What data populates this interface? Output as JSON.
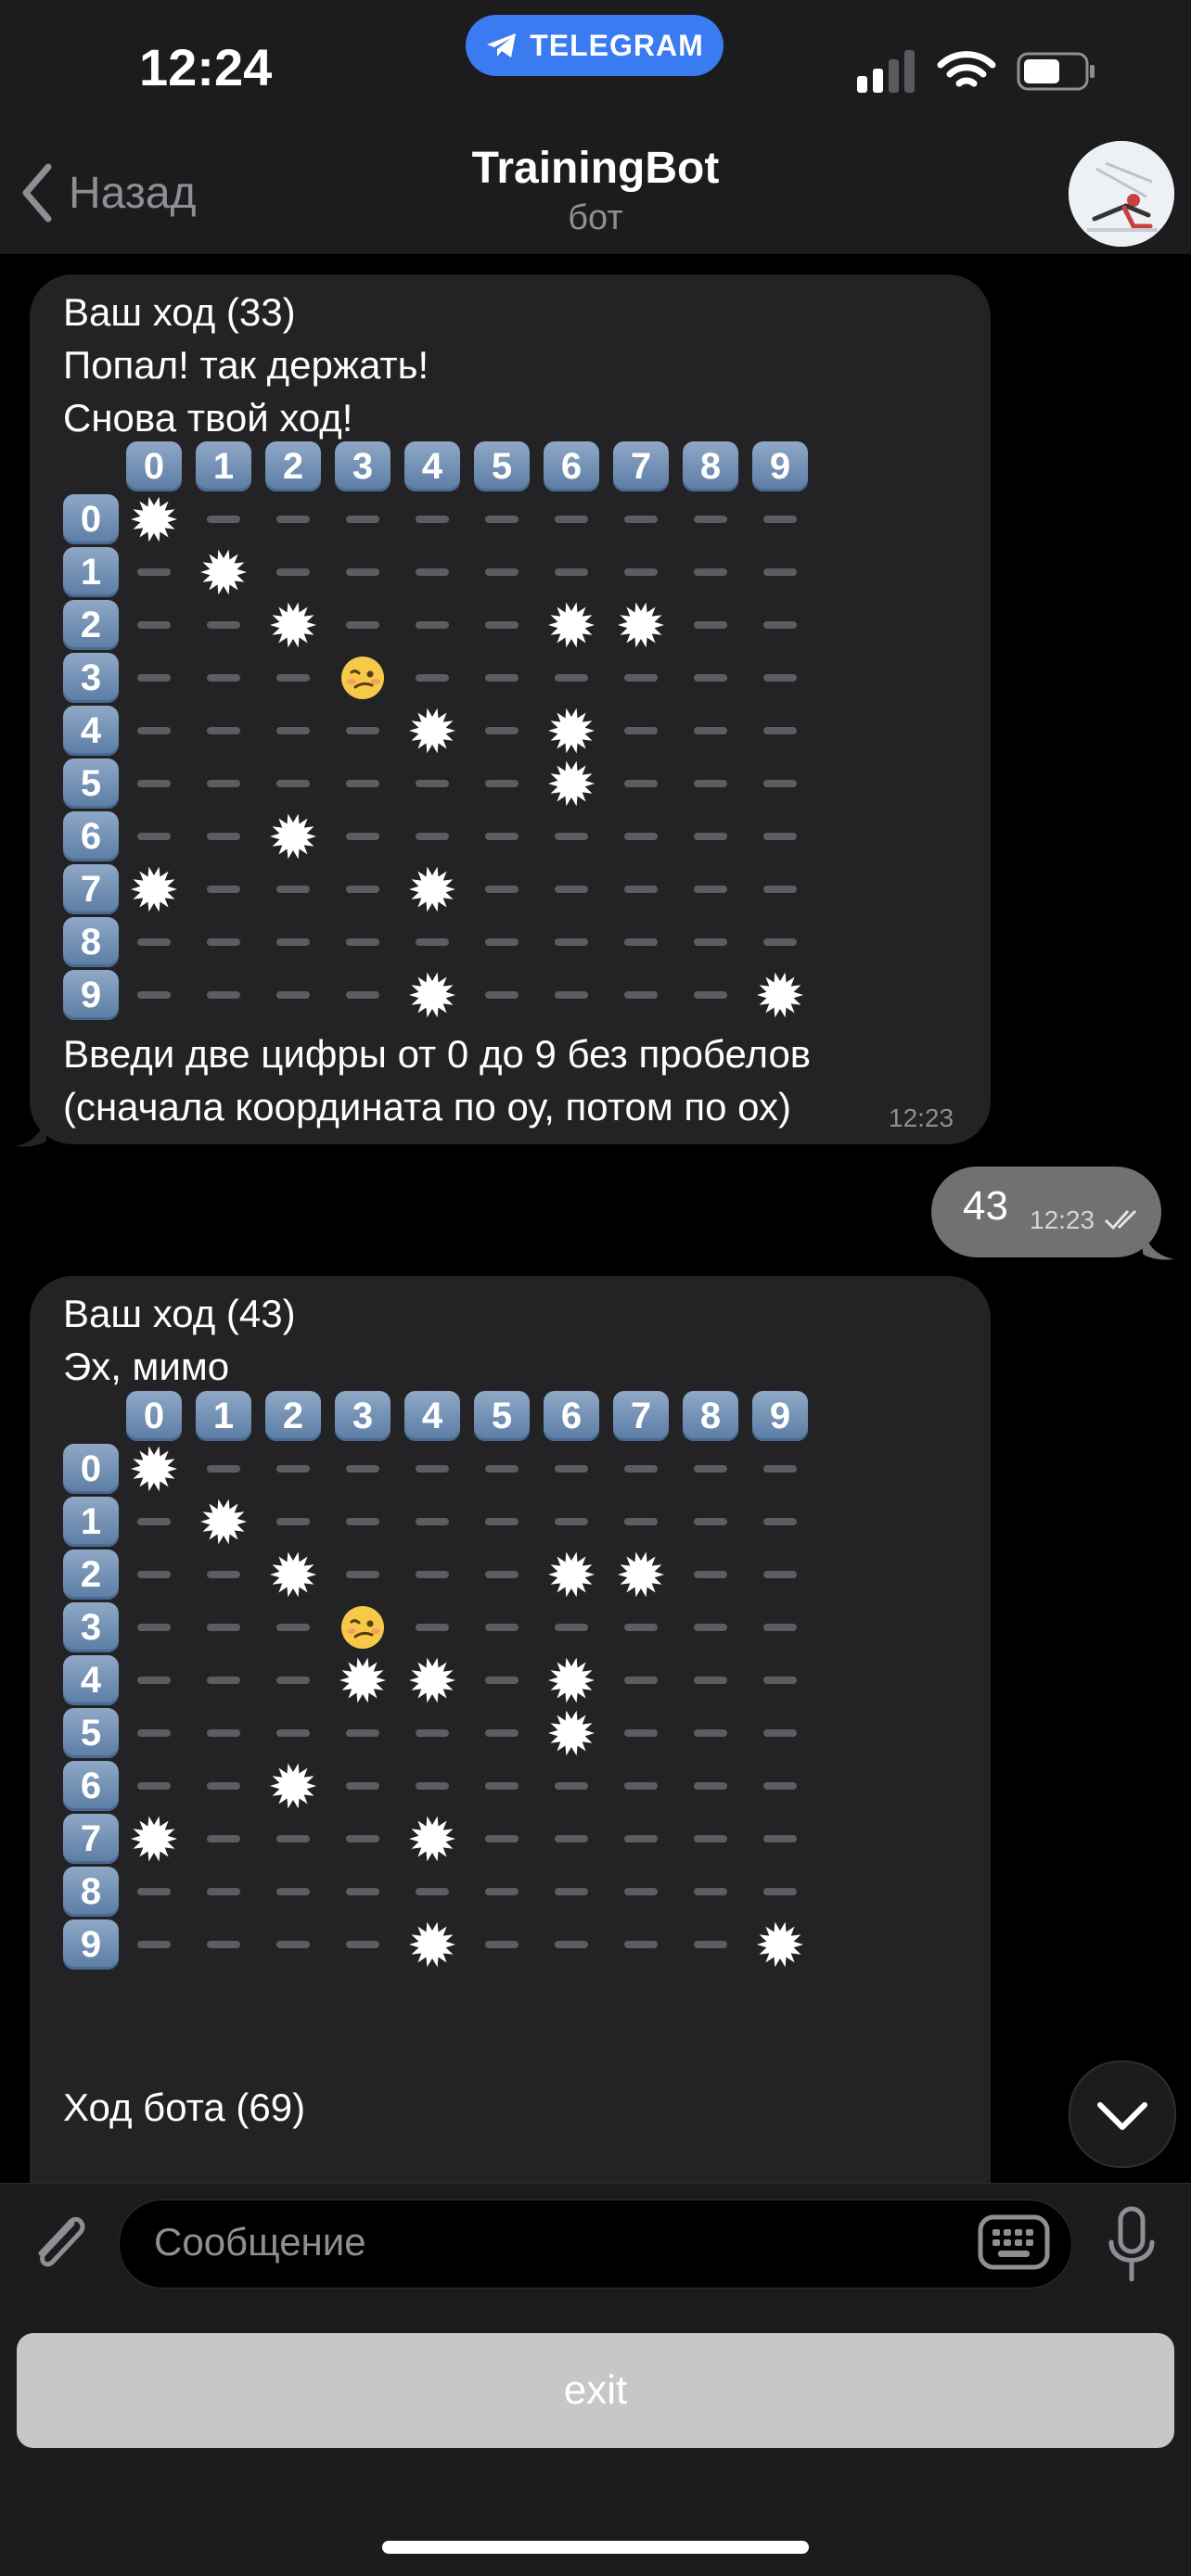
{
  "status_bar": {
    "time": "12:24",
    "app_pill": "TELEGRAM"
  },
  "nav": {
    "back_label": "Назад",
    "title": "TrainingBot",
    "subtitle": "бот"
  },
  "messages": [
    {
      "lines": [
        "Ваш ход (33)",
        "Попал! так держать!",
        "Снова твой ход!"
      ],
      "board": {
        "col_headers": [
          "0",
          "1",
          "2",
          "3",
          "4",
          "5",
          "6",
          "7",
          "8",
          "9"
        ],
        "row_headers": [
          "0",
          "1",
          "2",
          "3",
          "4",
          "5",
          "6",
          "7",
          "8",
          "9"
        ],
        "rows": [
          "X---------",
          "-X--------",
          "--X---XX--",
          "---O------",
          "----X-X---",
          "------X---",
          "--X-------",
          "X---X-----",
          "----------",
          "----X----X"
        ]
      },
      "footer_lines": [
        "Введи две цифры от 0 до 9 без пробелов",
        "(сначала координата по оу, потом по ох)"
      ],
      "time": "12:23"
    },
    {
      "outgoing_text": "43",
      "time": "12:23",
      "status_icon": "double-check-icon"
    },
    {
      "lines": [
        "Ваш ход (43)",
        "Эх, мимо"
      ],
      "board": {
        "col_headers": [
          "0",
          "1",
          "2",
          "3",
          "4",
          "5",
          "6",
          "7",
          "8",
          "9"
        ],
        "row_headers": [
          "0",
          "1",
          "2",
          "3",
          "4",
          "5",
          "6",
          "7",
          "8",
          "9"
        ],
        "rows": [
          "X---------",
          "-X--------",
          "--X---XX--",
          "---O------",
          "---XX-X---",
          "------X---",
          "--X-------",
          "X---X-----",
          "----------",
          "----X----X"
        ]
      },
      "bot_move": "Ход бота (69)"
    }
  ],
  "input": {
    "placeholder": "Сообщение"
  },
  "keyboard": {
    "exit_label": "exit"
  },
  "legend": {
    "X": "collision-icon",
    "O": "woozy-face-icon",
    "-": "empty-cell"
  },
  "colors": {
    "bubble_in": "#232325",
    "bubble_out": "#717171",
    "accent": "#3a7bf2",
    "key_header": "#6e8db4"
  }
}
